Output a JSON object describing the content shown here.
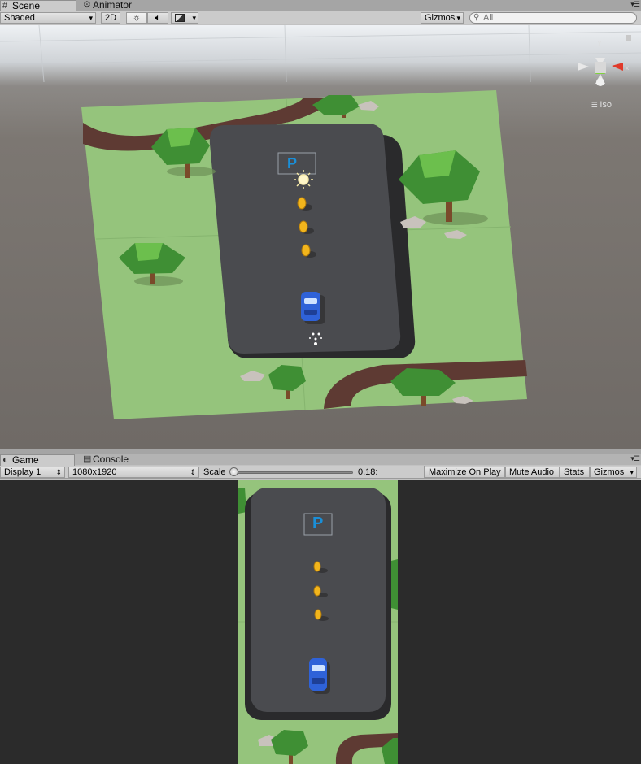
{
  "scene_tabs": {
    "scene_label": "Scene",
    "animator_label": "Animator",
    "menu_glyph": "▾☰"
  },
  "scene_toolbar": {
    "shading_mode": "Shaded",
    "mode_2d": "2D",
    "lighting_icon": "sun-icon",
    "audio_icon": "speaker-icon",
    "effects_icon": "image-icon",
    "gizmos_label": "Gizmos",
    "search_placeholder": "All"
  },
  "scene_view": {
    "projection_label": "Iso",
    "parking_sign": "P"
  },
  "game_tabs": {
    "game_label": "Game",
    "console_label": "Console",
    "menu_glyph": "▾☰"
  },
  "game_toolbar": {
    "display": "Display 1",
    "resolution": "1080x1920",
    "scale_label": "Scale",
    "scale_value": "0.18:",
    "scale_fraction": 0.0,
    "maximize_label": "Maximize On Play",
    "mute_label": "Mute Audio",
    "stats_label": "Stats",
    "gizmos_label": "Gizmos"
  },
  "game_view": {
    "parking_sign": "P"
  },
  "colors": {
    "grass": "#95c47c",
    "road": "#4a4b4f",
    "track": "#5e3a33",
    "coin": "#f2b51c",
    "car": "#2f62d8",
    "sign": "#1a8fd8",
    "gizmo_y": "#7fd23c",
    "gizmo_x": "#e03a2a"
  }
}
